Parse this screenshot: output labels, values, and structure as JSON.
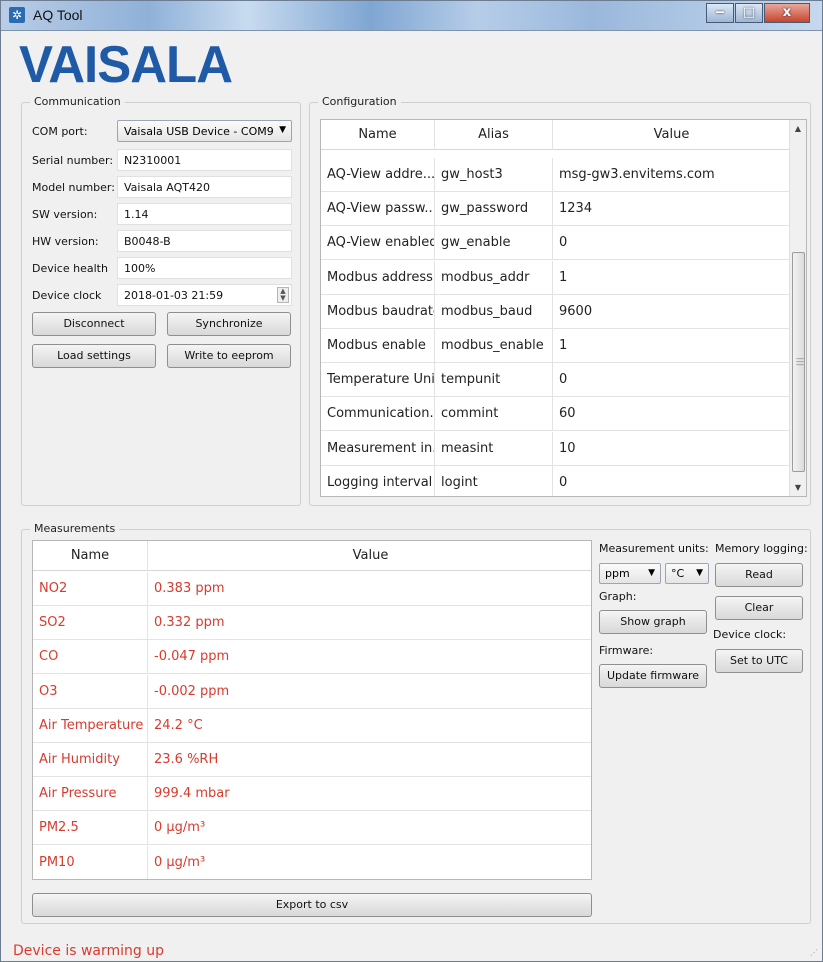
{
  "window": {
    "title": "AQ Tool",
    "min": "‒",
    "max": "□",
    "close": "x"
  },
  "logo": "VAISALA",
  "communication": {
    "legend": "Communication",
    "com_port_label": "COM port:",
    "com_port_value": "Vaisala USB Device - COM9",
    "serial_label": "Serial number:",
    "serial_value": "N2310001",
    "model_label": "Model number:",
    "model_value": "Vaisala AQT420",
    "sw_label": "SW version:",
    "sw_value": "1.14",
    "hw_label": "HW version:",
    "hw_value": "B0048-B",
    "health_label": "Device health",
    "health_value": "100%",
    "clock_label": "Device clock",
    "clock_value": "2018-01-03 21:59",
    "disconnect": "Disconnect",
    "synchronize": "Synchronize",
    "load_settings": "Load settings",
    "write_eeprom": "Write to eeprom"
  },
  "configuration": {
    "legend": "Configuration",
    "headers": [
      "Name",
      "Alias",
      "Value"
    ],
    "rows": [
      {
        "name": "AQ-View addre...",
        "alias": "gw_host3",
        "value": "msg-gw3.envitems.com"
      },
      {
        "name": "AQ-View passw...",
        "alias": "gw_password",
        "value": "1234"
      },
      {
        "name": "AQ-View enabled",
        "alias": "gw_enable",
        "value": "0"
      },
      {
        "name": "Modbus address",
        "alias": "modbus_addr",
        "value": "1"
      },
      {
        "name": "Modbus baudrate",
        "alias": "modbus_baud",
        "value": "9600"
      },
      {
        "name": "Modbus enable",
        "alias": "modbus_enable",
        "value": "1"
      },
      {
        "name": "Temperature Unit",
        "alias": "tempunit",
        "value": "0"
      },
      {
        "name": "Communication...",
        "alias": "commint",
        "value": "60"
      },
      {
        "name": "Measurement in...",
        "alias": "measint",
        "value": "10"
      },
      {
        "name": "Logging interval",
        "alias": "logint",
        "value": "0"
      }
    ]
  },
  "measurements": {
    "legend": "Measurements",
    "headers": [
      "Name",
      "Value"
    ],
    "rows": [
      {
        "name": "NO2",
        "value": "0.383 ppm"
      },
      {
        "name": "SO2",
        "value": "0.332 ppm"
      },
      {
        "name": "CO",
        "value": "-0.047 ppm"
      },
      {
        "name": "O3",
        "value": "-0.002 ppm"
      },
      {
        "name": "Air Temperature",
        "value": "24.2 °C"
      },
      {
        "name": "Air Humidity",
        "value": "23.6 %RH"
      },
      {
        "name": "Air Pressure",
        "value": "999.4 mbar"
      },
      {
        "name": "PM2.5",
        "value": "0 μg/m³"
      },
      {
        "name": "PM10",
        "value": "0 μg/m³"
      }
    ],
    "export": "Export to csv"
  },
  "side": {
    "units_label": "Measurement units:",
    "unit_conc": "ppm",
    "unit_temp": "°C",
    "graph_label": "Graph:",
    "show_graph": "Show graph",
    "firmware_label": "Firmware:",
    "update_firmware": "Update firmware",
    "memory_label": "Memory logging:",
    "read": "Read",
    "clear": "Clear",
    "device_clock_label": "Device clock:",
    "set_utc": "Set to UTC"
  },
  "status": "Device is warming up"
}
